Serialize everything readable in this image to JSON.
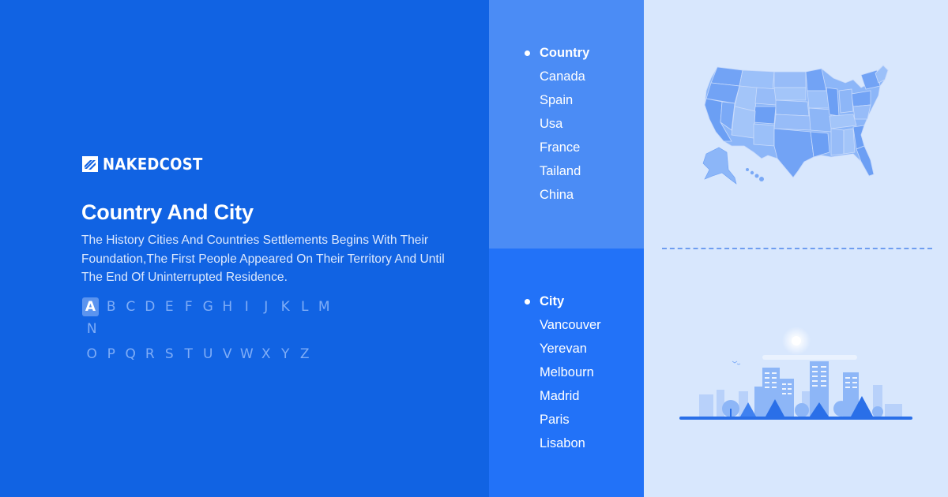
{
  "brand": {
    "name": "NAKEDCOST",
    "logo_icon": "z-stripes-logo-icon"
  },
  "hero": {
    "title": "Country And City",
    "description": "The History Cities And Countries Settlements Begins With Their Foundation,The First People Appeared On Their Territory And Until The End Of Uninterrupted Residence."
  },
  "alphabet": {
    "active": "A",
    "row1": [
      "A",
      "B",
      "C",
      "D",
      "E",
      "F",
      "G",
      "H",
      "I",
      "J",
      "K",
      "L",
      "M",
      "N"
    ],
    "row2": [
      "O",
      "P",
      "Q",
      "R",
      "S",
      "T",
      "U",
      "V",
      "W",
      "X",
      "Y",
      "Z"
    ]
  },
  "countries": {
    "heading": "Country",
    "items": [
      "Canada",
      "Spain",
      "Usa",
      "France",
      "Tailand",
      "China"
    ]
  },
  "cities": {
    "heading": "City",
    "items": [
      "Vancouver",
      "Yerevan",
      "Melbourn",
      "Madrid",
      "Paris",
      "Lisabon"
    ]
  },
  "illustrations": {
    "map": "usa-map-illustration",
    "city": "city-skyline-illustration"
  },
  "colors": {
    "primary": "#1163e3",
    "panel_top": "#4b8cf5",
    "panel_bottom": "#2272f8",
    "light": "#d8e7fd",
    "alphabet_inactive": "#7fadf7",
    "alphabet_active_bg": "#5b94ef"
  }
}
